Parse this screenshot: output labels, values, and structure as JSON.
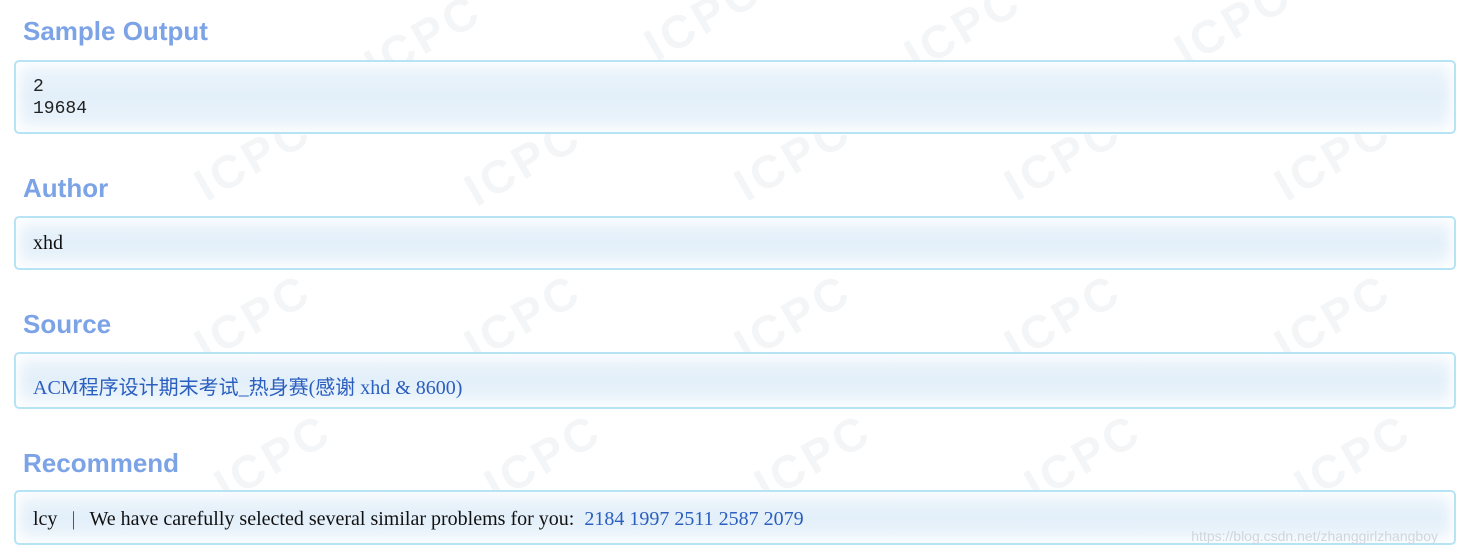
{
  "sections": {
    "sample_output": {
      "title": "Sample Output",
      "lines": [
        "2",
        "19684"
      ]
    },
    "author": {
      "title": "Author",
      "value": "xhd"
    },
    "source": {
      "title": "Source",
      "link_text": "ACM程序设计期末考试_热身赛(感谢 xhd & 8600)"
    },
    "recommend": {
      "title": "Recommend",
      "recommender": "lcy",
      "separator": "|",
      "intro": "We have carefully selected several similar problems for you:",
      "problems": [
        "2184",
        "1997",
        "2511",
        "2587",
        "2079"
      ]
    }
  },
  "background_watermark_text": "ICPC",
  "footer_watermark": "https://blog.csdn.net/zhanggirlzhangboy",
  "colors": {
    "title": "#7ca3e6",
    "panel_border": "#b7e4f5",
    "panel_bg": "#e3eff9",
    "link": "#2a5ebf"
  }
}
